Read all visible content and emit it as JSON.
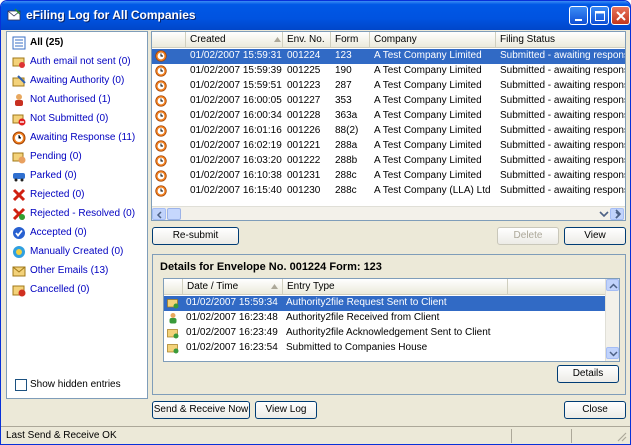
{
  "window": {
    "title": "eFiling Log for All Companies"
  },
  "sidebar": {
    "items": [
      {
        "label": "All (25)",
        "icon": "list-icon",
        "selected": true
      },
      {
        "label": "Auth email not sent (0)",
        "icon": "email-auth-icon"
      },
      {
        "label": "Awaiting Authority (0)",
        "icon": "envelope-pencil-icon"
      },
      {
        "label": "Not Authorised (1)",
        "icon": "person-red-icon"
      },
      {
        "label": "Not Submitted (0)",
        "icon": "stop-icon"
      },
      {
        "label": "Awaiting Response (11)",
        "icon": "clock-icon"
      },
      {
        "label": "Pending (0)",
        "icon": "hand-icon"
      },
      {
        "label": "Parked (0)",
        "icon": "parked-car-icon"
      },
      {
        "label": "Rejected (0)",
        "icon": "red-x-icon"
      },
      {
        "label": "Rejected - Resolved (0)",
        "icon": "green-x-icon"
      },
      {
        "label": "Accepted (0)",
        "icon": "blue-check-icon"
      },
      {
        "label": "Manually Created (0)",
        "icon": "manual-icon"
      },
      {
        "label": "Other Emails (13)",
        "icon": "envelope-icon"
      },
      {
        "label": "Cancelled (0)",
        "icon": "cancelled-icon"
      }
    ],
    "show_hidden_label": "Show hidden entries"
  },
  "log_table": {
    "columns": [
      "Created",
      "Env. No.",
      "Form",
      "Company",
      "Filing Status"
    ],
    "rows": [
      {
        "created": "01/02/2007  15:59:31",
        "env": "001224",
        "form": "123",
        "company": "A Test Company Limited",
        "status": "Submitted - awaiting response",
        "selected": true
      },
      {
        "created": "01/02/2007  15:59:39",
        "env": "001225",
        "form": "190",
        "company": "A Test Company Limited",
        "status": "Submitted - awaiting response"
      },
      {
        "created": "01/02/2007  15:59:51",
        "env": "001223",
        "form": "287",
        "company": "A Test Company Limited",
        "status": "Submitted - awaiting response"
      },
      {
        "created": "01/02/2007  16:00:05",
        "env": "001227",
        "form": "353",
        "company": "A Test Company Limited",
        "status": "Submitted - awaiting response"
      },
      {
        "created": "01/02/2007  16:00:34",
        "env": "001228",
        "form": "363a",
        "company": "A Test Company Limited",
        "status": "Submitted - awaiting response"
      },
      {
        "created": "01/02/2007  16:01:16",
        "env": "001226",
        "form": "88(2)",
        "company": "A Test Company Limited",
        "status": "Submitted - awaiting response"
      },
      {
        "created": "01/02/2007  16:02:19",
        "env": "001221",
        "form": "288a",
        "company": "A Test Company Limited",
        "status": "Submitted - awaiting response"
      },
      {
        "created": "01/02/2007  16:03:20",
        "env": "001222",
        "form": "288b",
        "company": "A Test Company Limited",
        "status": "Submitted - awaiting response"
      },
      {
        "created": "01/02/2007  16:10:38",
        "env": "001231",
        "form": "288c",
        "company": "A Test Company Limited",
        "status": "Submitted - awaiting response"
      },
      {
        "created": "01/02/2007  16:15:40",
        "env": "001230",
        "form": "288c",
        "company": "A Test Company (LLA) Ltd",
        "status": "Submitted - awaiting response"
      }
    ]
  },
  "actions": {
    "resubmit": "Re-submit",
    "delete": "Delete",
    "view": "View"
  },
  "details": {
    "title": "Details for Envelope No. 001224  Form: 123",
    "columns": [
      "Date / Time",
      "Entry Type"
    ],
    "rows": [
      {
        "datetime": "01/02/2007  15:59:34",
        "entry": "Authority2file Request Sent to Client",
        "selected": true
      },
      {
        "datetime": "01/02/2007  16:23:48",
        "entry": "Authority2file Received from Client"
      },
      {
        "datetime": "01/02/2007  16:23:49",
        "entry": "Authority2file Acknowledgement Sent to Client"
      },
      {
        "datetime": "01/02/2007  16:23:54",
        "entry": "Submitted to Companies House"
      }
    ],
    "details_button": "Details"
  },
  "footer": {
    "send_receive": "Send & Receive Now",
    "view_log": "View Log",
    "close": "Close"
  },
  "statusbar": {
    "text": "Last Send & Receive OK"
  },
  "colors": {
    "title_bar": "#0054e3",
    "selection": "#316ac5",
    "link_text": "#0000c0"
  }
}
